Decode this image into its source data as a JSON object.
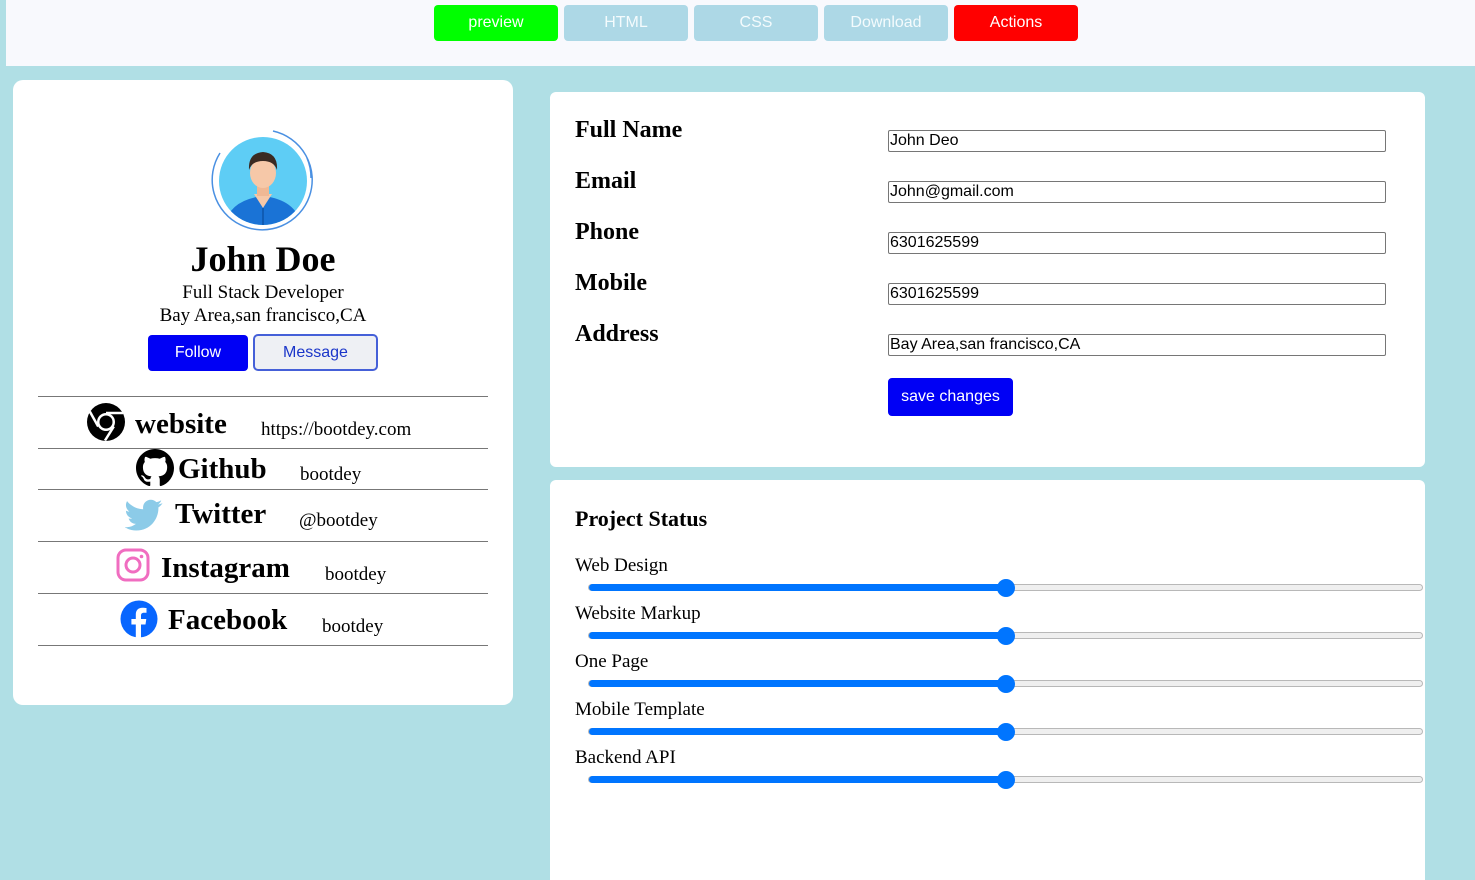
{
  "toolbar": {
    "buttons": [
      {
        "label": "preview",
        "color": "#00ff00"
      },
      {
        "label": "HTML",
        "color": "#add8e6"
      },
      {
        "label": "CSS",
        "color": "#add8e6"
      },
      {
        "label": "Download",
        "color": "#add8e6"
      },
      {
        "label": "Actions",
        "color": "#ff0000"
      }
    ]
  },
  "profile": {
    "name": "John Doe",
    "role": "Full Stack Developer",
    "location": "Bay Area,san francisco,CA",
    "follow_label": "Follow",
    "message_label": "Message",
    "socials": [
      {
        "label": "website",
        "value": "https://bootdey.com",
        "icon": "chrome-icon"
      },
      {
        "label": "Github",
        "value": "bootdey",
        "icon": "github-icon"
      },
      {
        "label": "Twitter",
        "value": "@bootdey",
        "icon": "twitter-icon"
      },
      {
        "label": "Instagram",
        "value": "bootdey",
        "icon": "instagram-icon"
      },
      {
        "label": "Facebook",
        "value": "bootdey",
        "icon": "facebook-icon"
      }
    ]
  },
  "form": {
    "fields": [
      {
        "label": "Full Name",
        "value": "John Deo"
      },
      {
        "label": "Email",
        "value": "John@gmail.com"
      },
      {
        "label": "Phone",
        "value": "6301625599"
      },
      {
        "label": "Mobile",
        "value": "6301625599"
      },
      {
        "label": "Address",
        "value": "Bay Area,san francisco,CA"
      }
    ],
    "save_label": "save changes"
  },
  "project": {
    "title": "Project Status",
    "items": [
      {
        "label": "Web Design",
        "progress": 0.5
      },
      {
        "label": "Website Markup",
        "progress": 0.5
      },
      {
        "label": "One Page",
        "progress": 0.5
      },
      {
        "label": "Mobile Template",
        "progress": 0.5
      },
      {
        "label": "Backend API",
        "progress": 0.5
      }
    ]
  },
  "colors": {
    "page_bg": "#b0dfe5",
    "primary_blue": "#0000f5",
    "slider_blue": "#0075ff"
  }
}
